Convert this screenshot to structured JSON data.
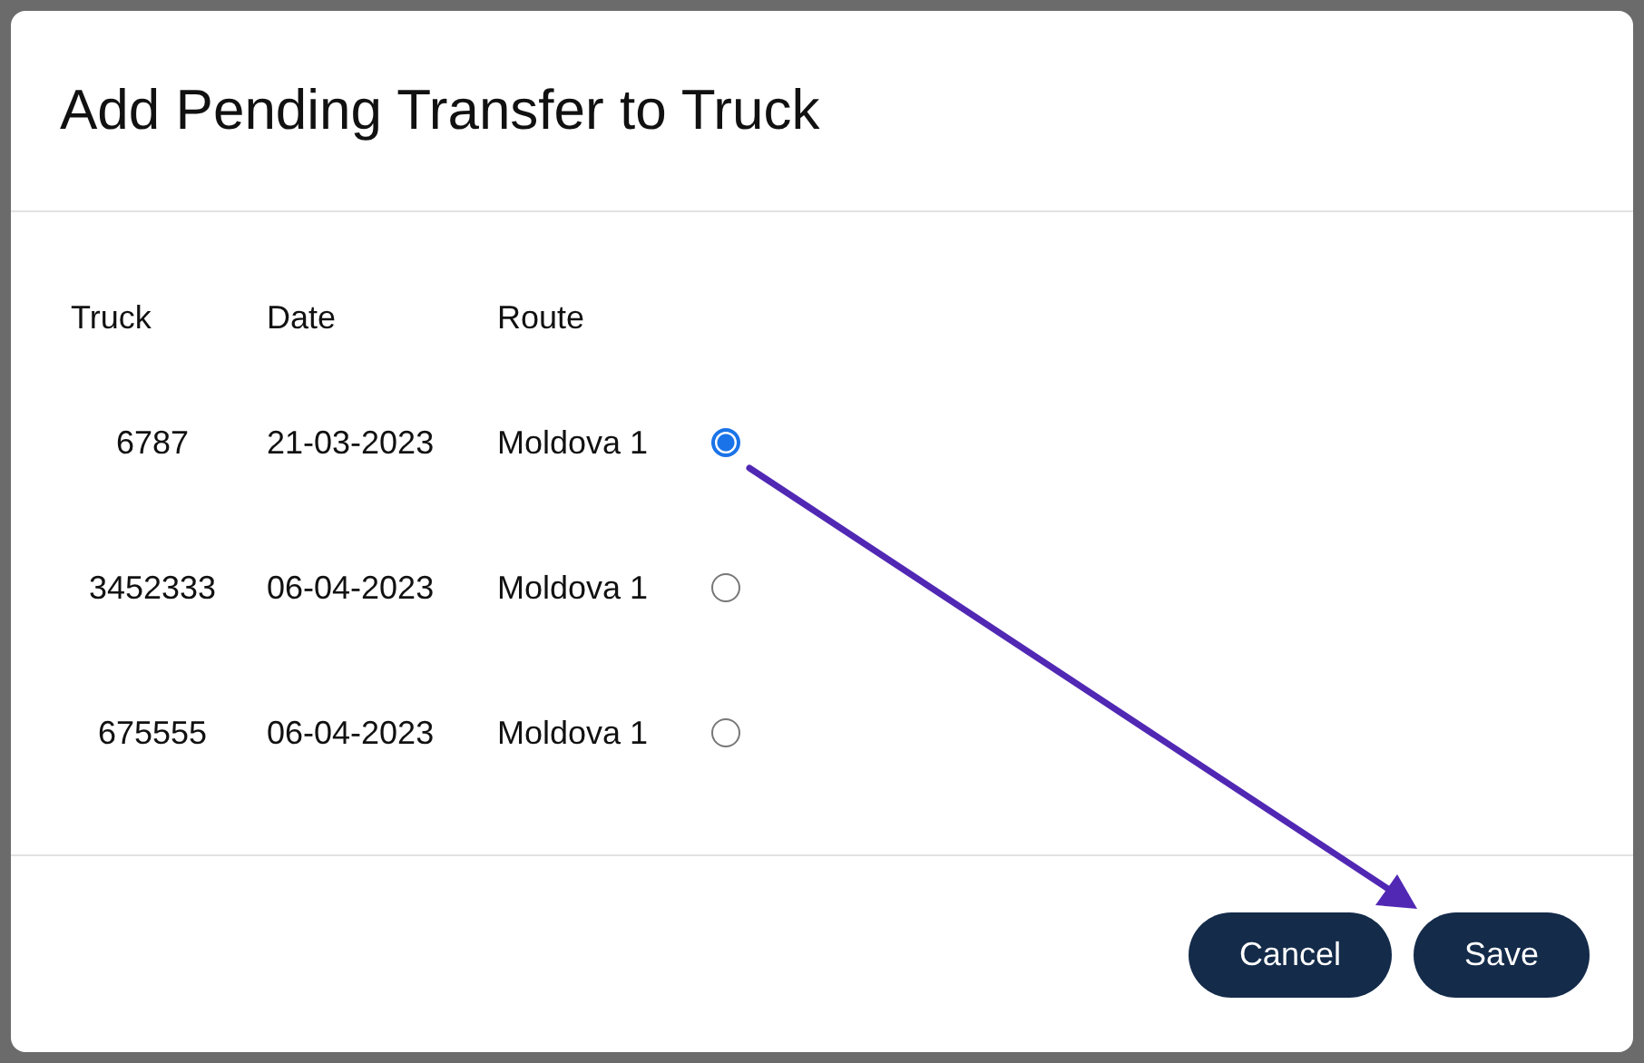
{
  "dialog": {
    "title": "Add Pending Transfer to Truck"
  },
  "table": {
    "columns": [
      "Truck",
      "Date",
      "Route"
    ],
    "rows": [
      {
        "truck": "6787",
        "date": "21-03-2023",
        "route": "Moldova 1",
        "selected": true
      },
      {
        "truck": "3452333",
        "date": "06-04-2023",
        "route": "Moldova 1",
        "selected": false
      },
      {
        "truck": "675555",
        "date": "06-04-2023",
        "route": "Moldova 1",
        "selected": false
      }
    ]
  },
  "buttons": [
    "Cancel",
    "Save"
  ]
}
